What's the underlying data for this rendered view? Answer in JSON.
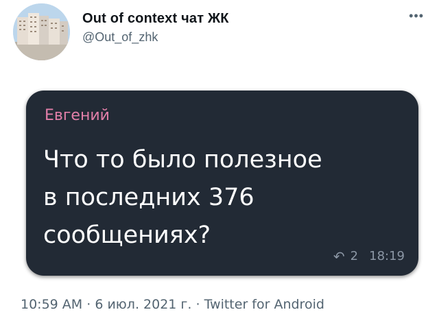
{
  "author": {
    "display_name": "Out of context чат ЖК",
    "handle": "@Out_of_zhk",
    "avatar_icon": "building-avatar-icon"
  },
  "more_icon": "more-icon",
  "message_card": {
    "sender": "Евгений",
    "lines": [
      "Что то было полезное",
      "в последних 376",
      "сообщениях?"
    ],
    "reply_count": "2",
    "time": "18:19",
    "reply_icon": "reply-icon"
  },
  "footer": {
    "time": "10:59 AM",
    "separator": "·",
    "date": "6 июл. 2021 г.",
    "source": "Twitter for Android"
  },
  "colors": {
    "bubble_bg": "#222a35",
    "sender": "#e27fa9",
    "meta": "#8c97a5",
    "muted": "#536471"
  }
}
